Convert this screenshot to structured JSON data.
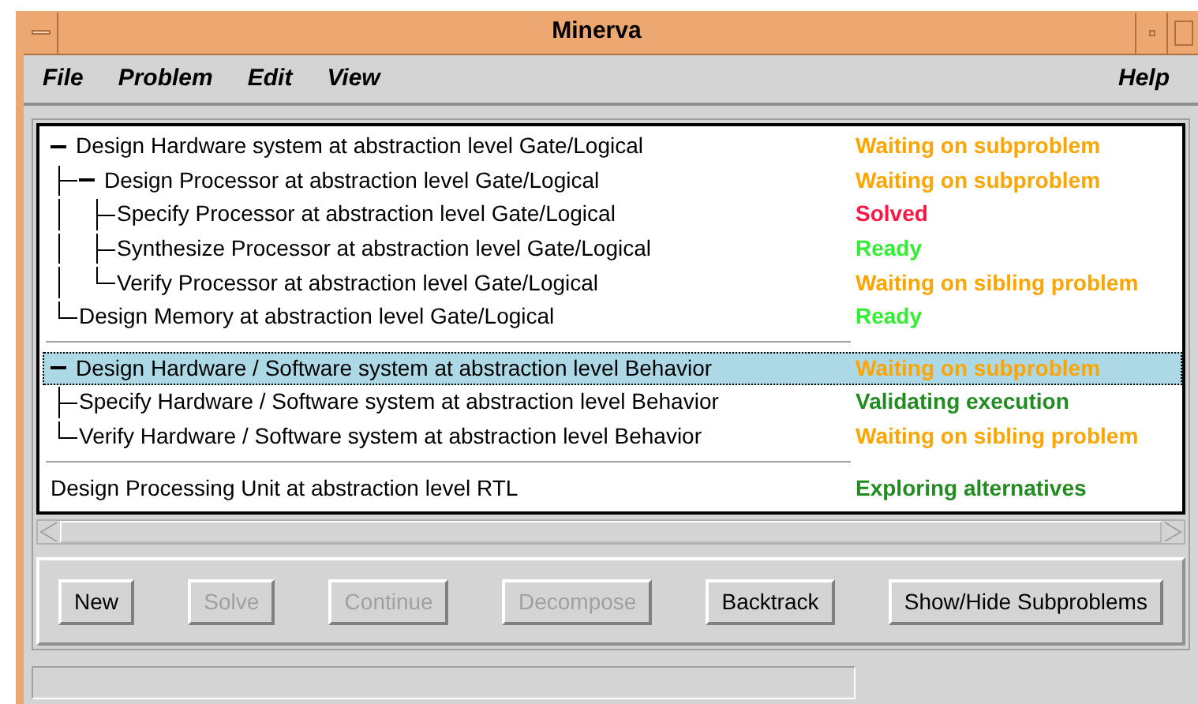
{
  "window": {
    "title": "Minerva"
  },
  "menu": [
    {
      "label": "File"
    },
    {
      "label": "Problem"
    },
    {
      "label": "Edit"
    },
    {
      "label": "View"
    }
  ],
  "help_menu": {
    "label": "Help"
  },
  "tree": [
    {
      "label": "Design Hardware system at abstraction level Gate/Logical",
      "status": "Waiting on subproblem",
      "color": "#ffa500",
      "expanded": true,
      "selected": false,
      "children": [
        {
          "label": "Design Processor at abstraction level Gate/Logical",
          "status": "Waiting on subproblem",
          "color": "#ffa500",
          "expanded": true,
          "selected": false,
          "children": [
            {
              "label": "Specify Processor at abstraction level Gate/Logical",
              "status": "Solved",
              "color": "#ff1744",
              "selected": false
            },
            {
              "label": "Synthesize Processor at abstraction level Gate/Logical",
              "status": "Ready",
              "color": "#33ee33",
              "selected": false
            },
            {
              "label": "Verify Processor at abstraction level Gate/Logical",
              "status": "Waiting on sibling problem",
              "color": "#ffa500",
              "selected": false
            }
          ]
        },
        {
          "label": "Design Memory at abstraction level Gate/Logical",
          "status": "Ready",
          "color": "#33ee33",
          "selected": false
        }
      ]
    },
    {
      "label": "Design Hardware / Software system at abstraction level Behavior",
      "status": "Waiting on subproblem",
      "color": "#ffa500",
      "expanded": true,
      "selected": true,
      "children": [
        {
          "label": "Specify Hardware / Software system at abstraction level Behavior",
          "status": "Validating execution",
          "color": "#228b22",
          "selected": false
        },
        {
          "label": "Verify Hardware / Software system at abstraction level Behavior",
          "status": "Waiting on sibling problem",
          "color": "#ffa500",
          "selected": false
        }
      ]
    },
    {
      "label": "Design Processing Unit at abstraction level RTL",
      "status": "Exploring alternatives",
      "color": "#228b22",
      "selected": false
    }
  ],
  "buttons": [
    {
      "label": "New",
      "disabled": false
    },
    {
      "label": "Solve",
      "disabled": true
    },
    {
      "label": "Continue",
      "disabled": true
    },
    {
      "label": "Decompose",
      "disabled": true
    },
    {
      "label": "Backtrack",
      "disabled": false
    },
    {
      "label": "Show/Hide Subproblems",
      "disabled": false
    }
  ]
}
